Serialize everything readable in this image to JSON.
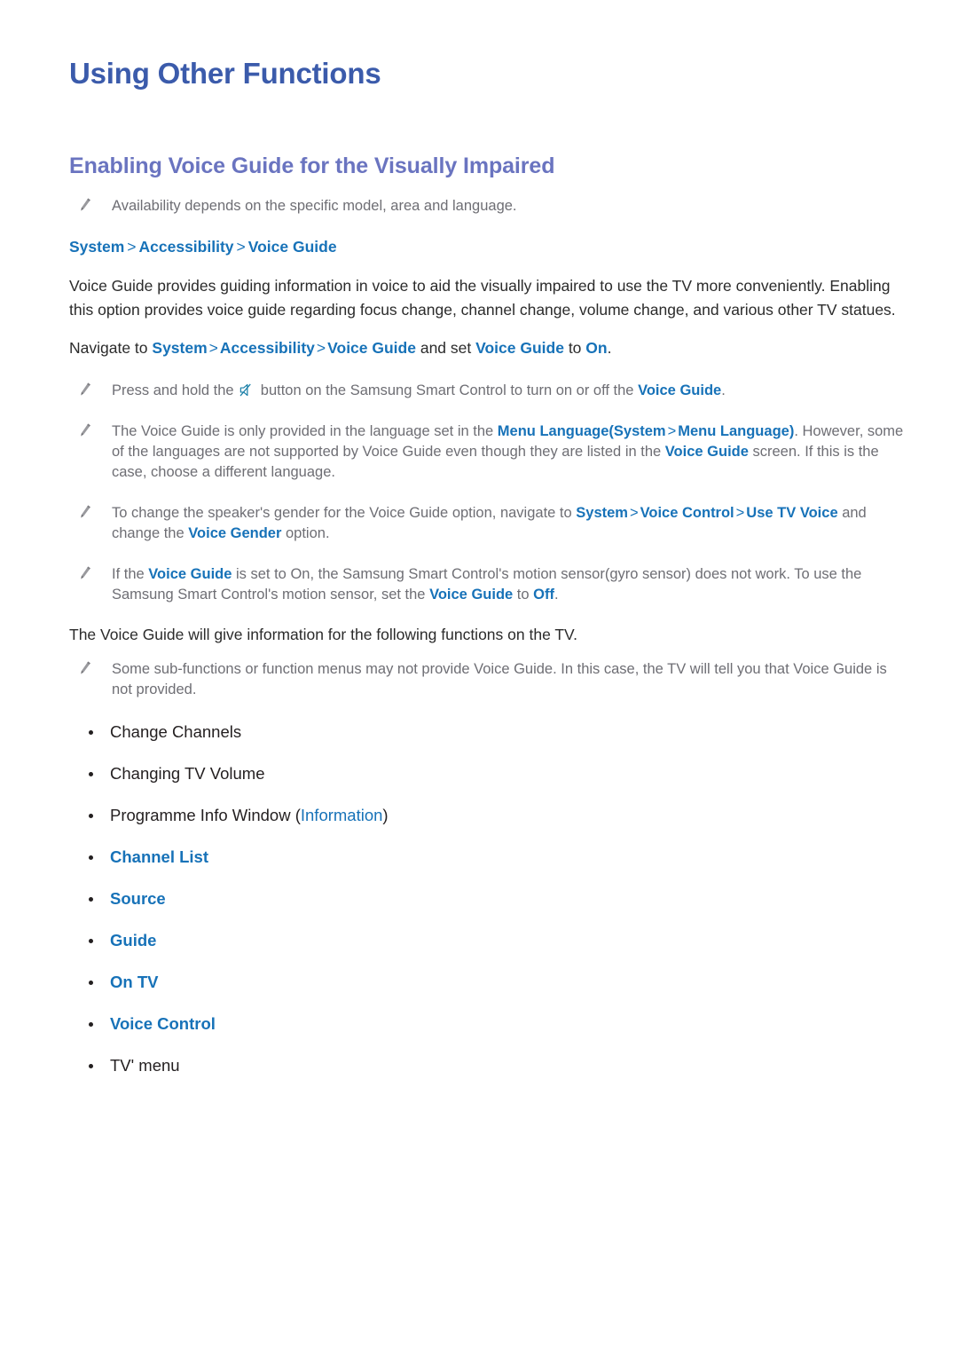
{
  "document": {
    "title": "Using Other Functions",
    "section_title": "Enabling Voice Guide for the Visually Impaired"
  },
  "colors": {
    "title_blue": "#3b5bab",
    "section_purple": "#6a74c0",
    "menu_blue": "#1772b8",
    "note_gray": "#6e6e74",
    "body_black": "#2b2b2b"
  },
  "availability_note": {
    "icon": "pencil-icon",
    "text": "Availability depends on the specific model, area and language."
  },
  "breadcrumb": {
    "items": [
      "System",
      "Accessibility",
      "Voice Guide"
    ],
    "separator": ">"
  },
  "intro_paragraph": "Voice Guide provides guiding information in voice to aid the visually impaired to use the TV more conveniently. Enabling this option provides voice guide regarding focus change, channel change, volume change, and various other TV statues.",
  "navigate_line": {
    "prefix": "Navigate to ",
    "path": [
      "System",
      "Accessibility",
      "Voice Guide"
    ],
    "separator": ">",
    "middle": " and set ",
    "target": "Voice Guide",
    "connector": " to ",
    "value": "On",
    "suffix": "."
  },
  "notes": [
    {
      "icon": "pencil-icon",
      "parts": [
        {
          "type": "text",
          "value": "Press and hold the "
        },
        {
          "type": "icon",
          "value": "mute-icon"
        },
        {
          "type": "text",
          "value": " button on the Samsung Smart Control to turn on or off the "
        },
        {
          "type": "accent",
          "value": "Voice Guide"
        },
        {
          "type": "text",
          "value": "."
        }
      ]
    },
    {
      "icon": "pencil-icon",
      "parts": [
        {
          "type": "text",
          "value": "The Voice Guide is only provided in the language set in the "
        },
        {
          "type": "accent",
          "value": "Menu Language"
        },
        {
          "type": "accent",
          "value": "(System"
        },
        {
          "type": "sep",
          "value": ">"
        },
        {
          "type": "accent",
          "value": "Menu Language)"
        },
        {
          "type": "text",
          "value": ". However, some of the languages are not supported by Voice Guide even though they are listed in the "
        },
        {
          "type": "accent",
          "value": "Voice Guide"
        },
        {
          "type": "text",
          "value": " screen. If this is the case, choose a different language."
        }
      ]
    },
    {
      "icon": "pencil-icon",
      "parts": [
        {
          "type": "text",
          "value": "To change the speaker's gender for the Voice Guide option, navigate to "
        },
        {
          "type": "accent",
          "value": "System"
        },
        {
          "type": "sep",
          "value": ">"
        },
        {
          "type": "accent",
          "value": "Voice Control"
        },
        {
          "type": "sep",
          "value": ">"
        },
        {
          "type": "accent",
          "value": "Use TV Voice"
        },
        {
          "type": "text",
          "value": " and change the "
        },
        {
          "type": "accent",
          "value": "Voice Gender"
        },
        {
          "type": "text",
          "value": " option."
        }
      ]
    },
    {
      "icon": "pencil-icon",
      "parts": [
        {
          "type": "text",
          "value": "If the "
        },
        {
          "type": "accent",
          "value": "Voice Guide"
        },
        {
          "type": "text",
          "value": " is set to On, the Samsung Smart Control's motion sensor(gyro sensor) does not work. To use the Samsung Smart Control's motion sensor, set the "
        },
        {
          "type": "accent",
          "value": "Voice Guide"
        },
        {
          "type": "text",
          "value": " to "
        },
        {
          "type": "accent",
          "value": "Off"
        },
        {
          "type": "text",
          "value": "."
        }
      ]
    }
  ],
  "functions_lead_in": "The Voice Guide will give information for the following functions on the TV.",
  "functions_note": {
    "icon": "pencil-icon",
    "text": "Some sub-functions or function menus may not provide Voice Guide. In this case, the TV will tell you that Voice Guide is not provided."
  },
  "feature_list": [
    {
      "label": "Change Channels",
      "accent": false
    },
    {
      "label": "Changing TV Volume",
      "accent": false
    },
    {
      "label": "Programme Info Window (Information)",
      "accent": false,
      "inline_accent": "Information"
    },
    {
      "label": "Channel List",
      "accent": true
    },
    {
      "label": "Source",
      "accent": true
    },
    {
      "label": "Guide",
      "accent": true
    },
    {
      "label": "On TV",
      "accent": true
    },
    {
      "label": "Voice Control",
      "accent": true
    },
    {
      "label": "TV' menu",
      "accent": false
    }
  ]
}
